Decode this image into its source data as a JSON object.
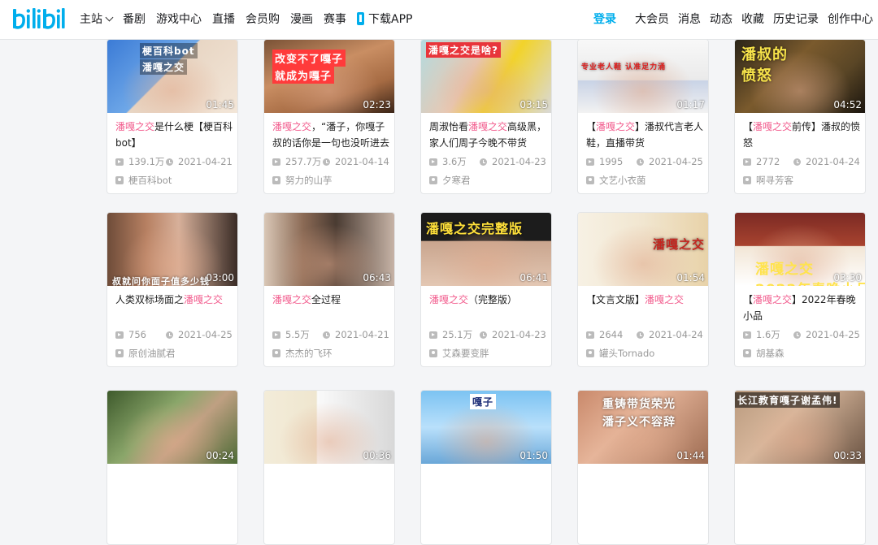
{
  "header": {
    "logo_text": "bilibili",
    "nav_left": [
      "主站",
      "番剧",
      "游戏中心",
      "直播",
      "会员购",
      "漫画",
      "赛事",
      "下载APP"
    ],
    "login": "登录",
    "nav_right": [
      "大会员",
      "消息",
      "动态",
      "收藏",
      "历史记录",
      "创作中心"
    ]
  },
  "colors": {
    "accent": "#00aeec",
    "highlight": "#f25d8e",
    "meta": "#999999"
  },
  "cards": [
    {
      "title_pre": "",
      "title_hl": "潘嘎之交",
      "title_post": "是什么梗【梗百科bot】",
      "duration": "01:45",
      "views": "139.1万",
      "date": "2021-04-21",
      "uploader": "梗百科bot",
      "caption": "梗百科bot / 潘嘎之交"
    },
    {
      "title_pre": "",
      "title_hl": "潘嘎之交",
      "title_post": "，“潘子，你嘎子叔的话你是一句也没听进去",
      "duration": "02:23",
      "views": "257.7万",
      "date": "2021-04-14",
      "uploader": "努力的山芋",
      "caption": "改变不了嘎子 / 就成为嘎子"
    },
    {
      "title_pre": "周淑怡看",
      "title_hl": "潘嘎之交",
      "title_post": "高级黑，家人们周子今晚不带货",
      "duration": "03:15",
      "views": "3.6万",
      "date": "2021-04-23",
      "uploader": "夕寒君",
      "caption": "潘嘎之交是啥?"
    },
    {
      "title_pre": "【",
      "title_hl": "潘嘎之交",
      "title_post": "】潘叔代言老人鞋，直播带货",
      "duration": "01:17",
      "views": "1995",
      "date": "2021-04-25",
      "uploader": "文艺小衣菌",
      "caption": "专业老人鞋 认准足力涌"
    },
    {
      "title_pre": "【",
      "title_hl": "潘嘎之交",
      "title_post": "前传】潘叔的愤怒",
      "duration": "04:52",
      "views": "2772",
      "date": "2021-04-24",
      "uploader": "啊寻芳客",
      "caption": "潘叔的 / 愤怒"
    },
    {
      "title_pre": "人类双标场面之",
      "title_hl": "潘嘎之交",
      "title_post": "",
      "duration": "03:00",
      "views": "756",
      "date": "2021-04-25",
      "uploader": "原创油腻君",
      "caption": "叔就问你面子值多少钱"
    },
    {
      "title_pre": "",
      "title_hl": "潘嘎之交",
      "title_post": "全过程",
      "duration": "06:43",
      "views": "5.5万",
      "date": "2021-04-21",
      "uploader": "杰杰的飞环",
      "caption": ""
    },
    {
      "title_pre": "",
      "title_hl": "潘嘎之交",
      "title_post": "（完整版）",
      "duration": "06:41",
      "views": "25.1万",
      "date": "2021-04-23",
      "uploader": "艾森要变胖",
      "caption": "潘嘎之交完整版"
    },
    {
      "title_pre": "【文言文版】",
      "title_hl": "潘嘎之交",
      "title_post": "",
      "duration": "01:54",
      "views": "2644",
      "date": "2021-04-24",
      "uploader": "罐头Tornado",
      "caption": "潘嘎之交"
    },
    {
      "title_pre": "【",
      "title_hl": "潘嘎之交",
      "title_post": "】2022年春晚小品",
      "duration": "03:30",
      "views": "1.6万",
      "date": "2021-04-25",
      "uploader": "胡基森",
      "caption": "潘嘎之交 / 2022年春晚小品"
    },
    {
      "duration": "00:24",
      "caption": ""
    },
    {
      "duration": "00:36",
      "caption": ""
    },
    {
      "duration": "01:50",
      "caption": "嘎子"
    },
    {
      "duration": "01:44",
      "caption": "重铸带货荣光 / 潘子义不容辞"
    },
    {
      "duration": "00:33",
      "caption": "长江教育嘎子谢孟伟!"
    }
  ]
}
